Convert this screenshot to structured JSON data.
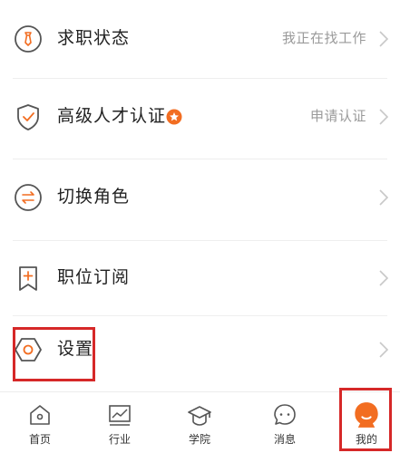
{
  "menu": {
    "items": [
      {
        "label": "求职状态",
        "value": "我正在找工作",
        "icon": "tie-icon"
      },
      {
        "label": "高级人才认证",
        "value": "申请认证",
        "icon": "shield-check-icon"
      },
      {
        "label": "切换角色",
        "value": "",
        "icon": "swap-icon"
      },
      {
        "label": "职位订阅",
        "value": "",
        "icon": "bookmark-plus-icon"
      },
      {
        "label": "设置",
        "value": "",
        "icon": "settings-hexagon-icon"
      }
    ]
  },
  "bottom_nav": {
    "items": [
      {
        "label": "首页",
        "icon": "home-icon"
      },
      {
        "label": "行业",
        "icon": "chart-icon"
      },
      {
        "label": "学院",
        "icon": "graduation-cap-icon"
      },
      {
        "label": "消息",
        "icon": "message-icon"
      },
      {
        "label": "我的",
        "icon": "profile-icon",
        "active": true
      }
    ]
  },
  "colors": {
    "accent": "#f26d21",
    "icon_gray": "#555555",
    "highlight": "#d62828"
  }
}
